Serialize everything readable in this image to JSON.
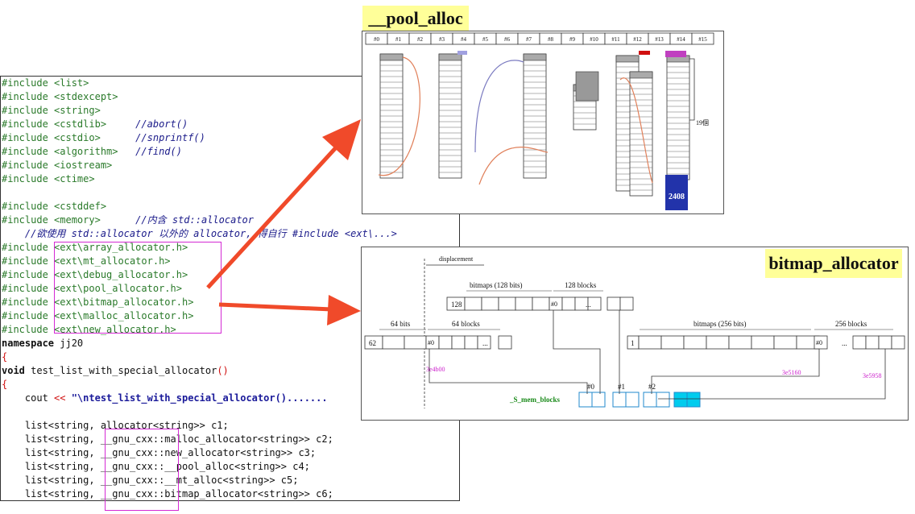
{
  "titles": {
    "pool": "__pool_alloc",
    "bitmap": "bitmap_allocator"
  },
  "code_lines": [
    {
      "segs": [
        {
          "t": "#include <list>",
          "c": "inc"
        }
      ]
    },
    {
      "segs": [
        {
          "t": "#include <stdexcept>",
          "c": "inc"
        }
      ]
    },
    {
      "segs": [
        {
          "t": "#include <string>",
          "c": "inc"
        }
      ]
    },
    {
      "segs": [
        {
          "t": "#include <cstdlib>     ",
          "c": "inc"
        },
        {
          "t": "//abort()",
          "c": "cmt"
        }
      ]
    },
    {
      "segs": [
        {
          "t": "#include <cstdio>      ",
          "c": "inc"
        },
        {
          "t": "//snprintf()",
          "c": "cmt"
        }
      ]
    },
    {
      "segs": [
        {
          "t": "#include <algorithm>   ",
          "c": "inc"
        },
        {
          "t": "//find()",
          "c": "cmt"
        }
      ]
    },
    {
      "segs": [
        {
          "t": "#include <iostream>",
          "c": "inc"
        }
      ]
    },
    {
      "segs": [
        {
          "t": "#include <ctime>",
          "c": "inc"
        }
      ]
    },
    {
      "segs": [
        {
          "t": "",
          "c": "plain"
        }
      ]
    },
    {
      "segs": [
        {
          "t": "#include <cstddef>",
          "c": "inc"
        }
      ]
    },
    {
      "segs": [
        {
          "t": "#include <memory>      ",
          "c": "inc"
        },
        {
          "t": "//内含 std::allocator",
          "c": "cmt"
        }
      ]
    },
    {
      "segs": [
        {
          "t": "    //欲使用 std::allocator 以外的 allocator, 得自行 #include <ext\\...>",
          "c": "cmt"
        }
      ]
    },
    {
      "segs": [
        {
          "t": "#include <ext\\array_allocator.h>",
          "c": "inc"
        }
      ]
    },
    {
      "segs": [
        {
          "t": "#include <ext\\mt_allocator.h>",
          "c": "inc"
        }
      ]
    },
    {
      "segs": [
        {
          "t": "#include <ext\\debug_allocator.h>",
          "c": "inc"
        }
      ]
    },
    {
      "segs": [
        {
          "t": "#include <ext\\pool_allocator.h>",
          "c": "inc"
        }
      ]
    },
    {
      "segs": [
        {
          "t": "#include <ext\\bitmap_allocator.h>",
          "c": "inc"
        }
      ]
    },
    {
      "segs": [
        {
          "t": "#include <ext\\malloc_allocator.h>",
          "c": "inc"
        }
      ]
    },
    {
      "segs": [
        {
          "t": "#include <ext\\new_allocator.h>",
          "c": "inc"
        }
      ]
    },
    {
      "segs": [
        {
          "t": "namespace",
          "c": "kw"
        },
        {
          "t": " jj20",
          "c": "plain"
        }
      ]
    },
    {
      "segs": [
        {
          "t": "{",
          "c": "red"
        }
      ]
    },
    {
      "segs": [
        {
          "t": "void",
          "c": "kw"
        },
        {
          "t": " test_list_with_special_allocator",
          "c": "plain"
        },
        {
          "t": "()",
          "c": "red"
        }
      ]
    },
    {
      "segs": [
        {
          "t": "{",
          "c": "red"
        }
      ]
    },
    {
      "segs": [
        {
          "t": "    cout ",
          "c": "plain"
        },
        {
          "t": "<<",
          "c": "red"
        },
        {
          "t": " \"\\ntest_list_with_special_allocator().......",
          "c": "str"
        }
      ]
    },
    {
      "segs": [
        {
          "t": "",
          "c": "plain"
        }
      ]
    },
    {
      "segs": [
        {
          "t": "    list<string, allocator<string>> c1;",
          "c": "plain"
        }
      ]
    },
    {
      "segs": [
        {
          "t": "    list<string, __gnu_cxx::malloc_allocator<string>> c2;",
          "c": "plain"
        }
      ]
    },
    {
      "segs": [
        {
          "t": "    list<string, __gnu_cxx::new_allocator<string>> c3;",
          "c": "plain"
        }
      ]
    },
    {
      "segs": [
        {
          "t": "    list<string, __gnu_cxx::__pool_alloc<string>> c4;",
          "c": "plain"
        }
      ]
    },
    {
      "segs": [
        {
          "t": "    list<string, __gnu_cxx::__mt_alloc<string>> c5;",
          "c": "plain"
        }
      ]
    },
    {
      "segs": [
        {
          "t": "    list<string, __gnu_cxx::bitmap_allocator<string>> c6;",
          "c": "plain"
        }
      ]
    }
  ],
  "pool": {
    "slots": [
      "#0",
      "#1",
      "#2",
      "#3",
      "#4",
      "#5",
      "#6",
      "#7",
      "#8",
      "#9",
      "#10",
      "#11",
      "#12",
      "#13",
      "#14",
      "#15"
    ],
    "count_label": "19個",
    "value_label": "2408"
  },
  "bitmap": {
    "displacement": "displacement",
    "bitmaps_128": "bitmaps (128 bits)",
    "blocks_128": "128 blocks",
    "bits_64": "64 bits",
    "blocks_64": "64 blocks",
    "bitmaps_256": "bitmaps (256 bits)",
    "blocks_256": "256 blocks",
    "n128": "128",
    "n62": "62",
    "n1": "1",
    "h0": "#0",
    "dots": "...",
    "addr1": "3e4b00",
    "addr2": "3e5160",
    "addr3": "3e5958",
    "mem_label": "_S_mem_blocks",
    "i0": "#0",
    "i1": "#1",
    "i2": "#2"
  },
  "colors": {
    "arrow": "#f04a2a",
    "highlight": "#d42ad4",
    "title_bg": "#ffff99",
    "mem_cell": "#00ccee"
  }
}
